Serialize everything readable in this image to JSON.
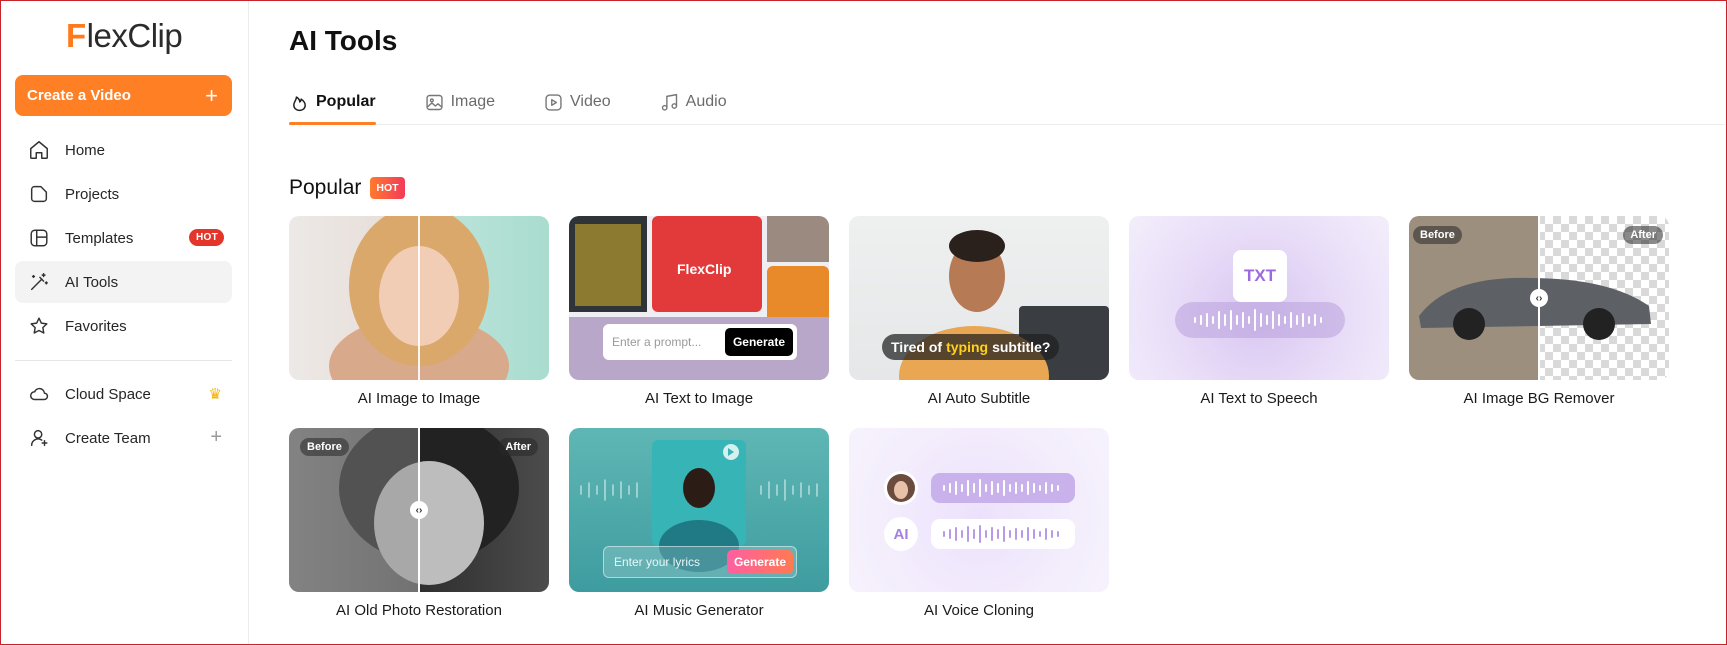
{
  "brand": {
    "logo_letter": "F",
    "logo_rest": "lexClip"
  },
  "sidebar": {
    "create_label": "Create a Video",
    "create_plus": "+",
    "items": [
      {
        "label": "Home",
        "icon": "home-icon"
      },
      {
        "label": "Projects",
        "icon": "projects-icon"
      },
      {
        "label": "Templates",
        "icon": "templates-icon",
        "badge": "HOT"
      },
      {
        "label": "AI Tools",
        "icon": "magic-wand-icon",
        "active": true
      },
      {
        "label": "Favorites",
        "icon": "star-icon"
      }
    ],
    "items2": [
      {
        "label": "Cloud Space",
        "icon": "cloud-icon",
        "extra": "crown-icon"
      },
      {
        "label": "Create Team",
        "icon": "add-user-icon",
        "extra": "plus-icon"
      }
    ],
    "crown_glyph": "♛",
    "team_plus": "+"
  },
  "main": {
    "title": "AI Tools",
    "tabs": [
      {
        "label": "Popular",
        "icon": "flame-icon",
        "active": true
      },
      {
        "label": "Image",
        "icon": "image-icon"
      },
      {
        "label": "Video",
        "icon": "video-icon"
      },
      {
        "label": "Audio",
        "icon": "music-icon"
      }
    ],
    "section_title": "Popular",
    "section_badge": "HOT",
    "cards": [
      {
        "label": "AI Image to Image"
      },
      {
        "label": "AI Text to Image",
        "prompt_placeholder": "Enter a prompt...",
        "button": "Generate",
        "image_text": "FlexClip"
      },
      {
        "label": "AI Auto Subtitle",
        "caption_pre": "Tired of",
        "caption_hl": "typing",
        "caption_post": "subtitle?"
      },
      {
        "label": "AI Text to Speech",
        "doc_text": "TXT"
      },
      {
        "label": "AI Image BG Remover",
        "before": "Before",
        "after": "After"
      },
      {
        "label": "AI Old Photo Restoration",
        "before": "Before",
        "after": "After"
      },
      {
        "label": "AI Music Generator",
        "prompt_placeholder": "Enter your lyrics",
        "button": "Generate"
      },
      {
        "label": "AI Voice Cloning",
        "ai_text": "AI"
      }
    ]
  },
  "colors": {
    "accent": "#ff7f24",
    "hot": "#e5352b",
    "active_bg": "#f3f3f4"
  }
}
